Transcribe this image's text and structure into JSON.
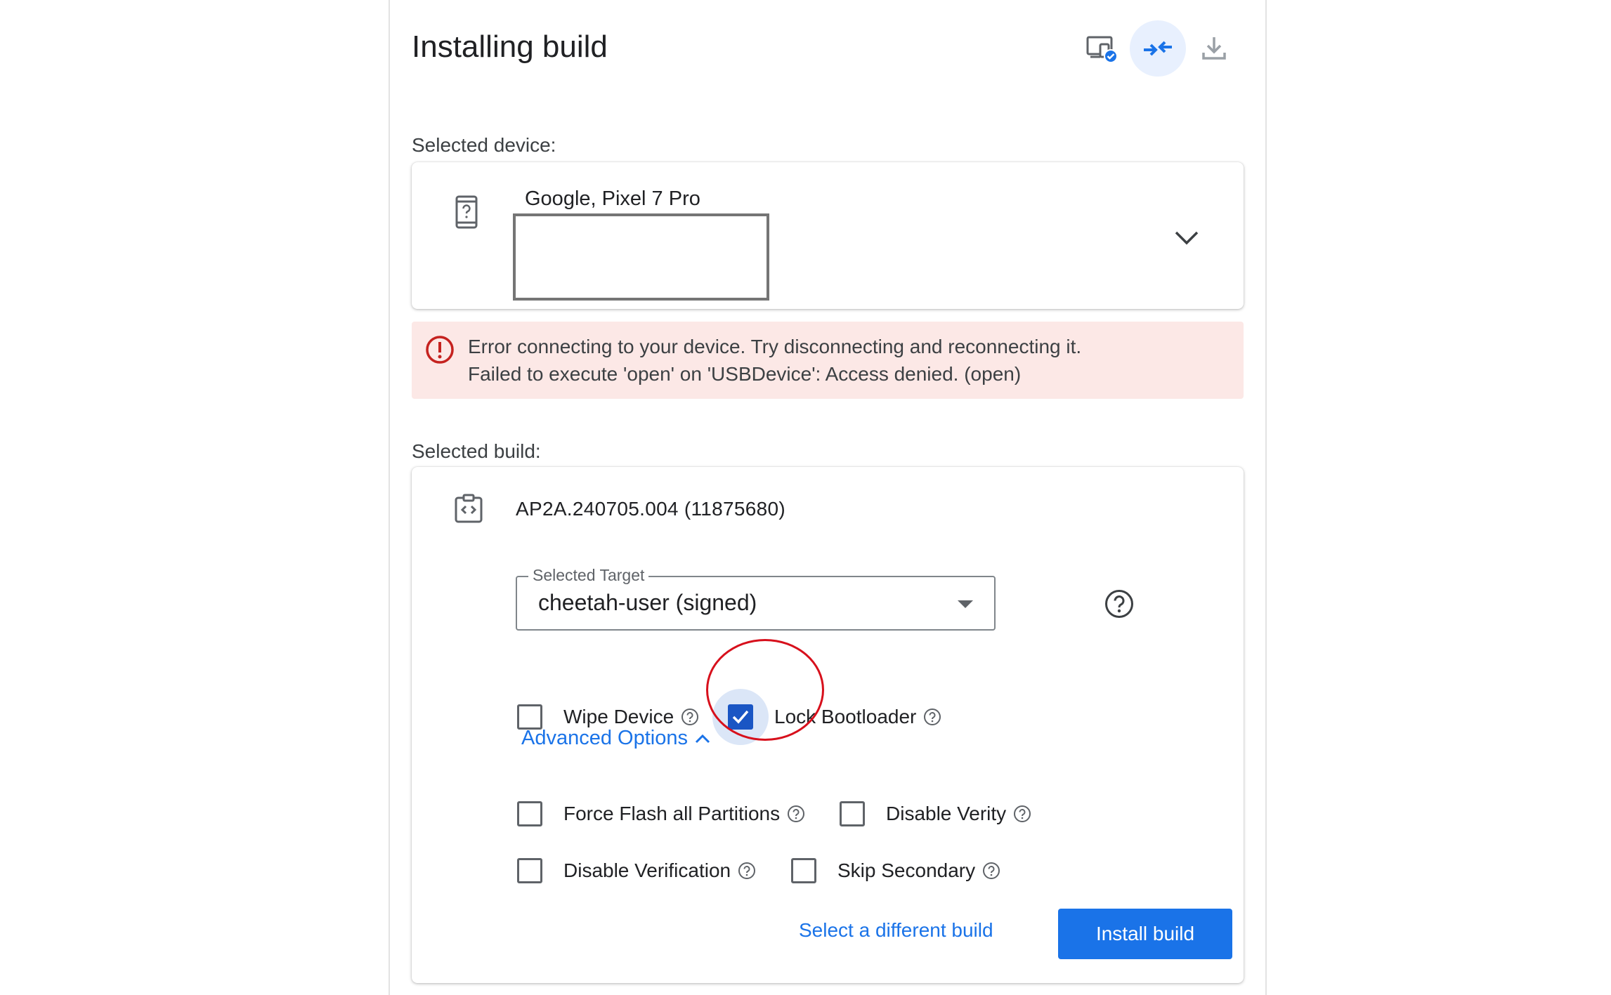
{
  "header": {
    "title": "Installing build",
    "toolbar_icons": [
      "device-check-icon",
      "connect-icon",
      "download-icon"
    ]
  },
  "device_section": {
    "label": "Selected device:",
    "device_name": "Google, Pixel 7 Pro",
    "icon": "phone-unknown-icon"
  },
  "error": {
    "line1": "Error connecting to your device. Try disconnecting and reconnecting it.",
    "line2": "Failed to execute 'open' on 'USBDevice': Access denied. (open)",
    "icon": "error-icon",
    "color": "#fce8e6"
  },
  "build_section": {
    "label": "Selected build:",
    "build_name": "AP2A.240705.004 (11875680)",
    "icon": "build-code-icon",
    "target_label": "Selected Target",
    "target_value": "cheetah-user (signed)",
    "options": {
      "wipe_device": {
        "label": "Wipe Device",
        "checked": false
      },
      "lock_bootloader": {
        "label": "Lock Bootloader",
        "checked": true
      }
    },
    "advanced_label": "Advanced Options",
    "advanced": {
      "force_flash": {
        "label": "Force Flash all Partitions",
        "checked": false
      },
      "disable_verity": {
        "label": "Disable Verity",
        "checked": false
      },
      "disable_verification": {
        "label": "Disable Verification",
        "checked": false
      },
      "skip_secondary": {
        "label": "Skip Secondary",
        "checked": false
      }
    },
    "select_different": "Select a different build",
    "install": "Install build"
  },
  "colors": {
    "accent": "#1a73e8",
    "checkbox_checked": "#1a56c4",
    "annotation": "#d7101c"
  }
}
